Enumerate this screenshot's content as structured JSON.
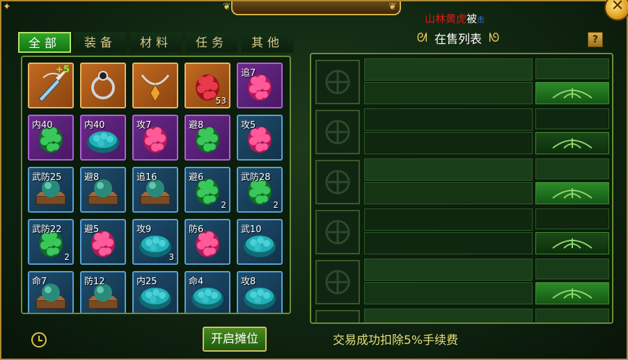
{
  "broadcast": {
    "name": "山林黄虎",
    "word": "被",
    "tail": "击"
  },
  "close_icon": "close-x-icon",
  "tabs": [
    {
      "label": "全部",
      "active": true
    },
    {
      "label": "装备",
      "active": false
    },
    {
      "label": "材料",
      "active": false
    },
    {
      "label": "任务",
      "active": false
    },
    {
      "label": "其他",
      "active": false
    }
  ],
  "inventory": [
    {
      "label": "",
      "plus": "+5",
      "count": "",
      "quality": "orange",
      "icon": "dagger-icon"
    },
    {
      "label": "",
      "plus": "",
      "count": "",
      "quality": "orange",
      "icon": "ring-icon"
    },
    {
      "label": "",
      "plus": "",
      "count": "",
      "quality": "orange",
      "icon": "amulet-icon"
    },
    {
      "label": "",
      "plus": "",
      "count": "53",
      "quality": "orange",
      "icon": "red-gem-icon"
    },
    {
      "label": "追7",
      "plus": "",
      "count": "",
      "quality": "purple",
      "icon": "pink-gem-icon"
    },
    {
      "label": "内40",
      "plus": "",
      "count": "",
      "quality": "purple",
      "icon": "green-gem-icon"
    },
    {
      "label": "内40",
      "plus": "",
      "count": "",
      "quality": "purple",
      "icon": "teal-gem-icon"
    },
    {
      "label": "攻7",
      "plus": "",
      "count": "",
      "quality": "purple",
      "icon": "pink-gem-icon"
    },
    {
      "label": "避8",
      "plus": "",
      "count": "",
      "quality": "purple",
      "icon": "green-gem-icon"
    },
    {
      "label": "攻5",
      "plus": "",
      "count": "",
      "quality": "blue",
      "icon": "pink-gem-icon"
    },
    {
      "label": "武防25",
      "plus": "",
      "count": "",
      "quality": "blue",
      "icon": "orb-chest-icon"
    },
    {
      "label": "避8",
      "plus": "",
      "count": "",
      "quality": "blue",
      "icon": "orb-chest-icon"
    },
    {
      "label": "追16",
      "plus": "",
      "count": "",
      "quality": "blue",
      "icon": "orb-chest-icon"
    },
    {
      "label": "避6",
      "plus": "",
      "count": "2",
      "quality": "blue",
      "icon": "green-gem-icon"
    },
    {
      "label": "武防28",
      "plus": "",
      "count": "2",
      "quality": "blue",
      "icon": "green-gem-icon"
    },
    {
      "label": "武防22",
      "plus": "",
      "count": "2",
      "quality": "blue",
      "icon": "green-gem-icon"
    },
    {
      "label": "避5",
      "plus": "",
      "count": "",
      "quality": "blue",
      "icon": "pink-gem-icon"
    },
    {
      "label": "攻9",
      "plus": "",
      "count": "3",
      "quality": "blue",
      "icon": "teal-gem-icon"
    },
    {
      "label": "防6",
      "plus": "",
      "count": "",
      "quality": "blue",
      "icon": "pink-gem-icon"
    },
    {
      "label": "武10",
      "plus": "",
      "count": "",
      "quality": "blue",
      "icon": "teal-gem-icon"
    },
    {
      "label": "命7",
      "plus": "",
      "count": "",
      "quality": "blue",
      "icon": "orb-chest-icon"
    },
    {
      "label": "防12",
      "plus": "",
      "count": "",
      "quality": "blue",
      "icon": "orb-chest-icon"
    },
    {
      "label": "内25",
      "plus": "",
      "count": "",
      "quality": "blue",
      "icon": "teal-gem-icon"
    },
    {
      "label": "命4",
      "plus": "",
      "count": "",
      "quality": "blue",
      "icon": "teal-gem-icon"
    },
    {
      "label": "攻8",
      "plus": "",
      "count": "",
      "quality": "blue",
      "icon": "teal-gem-icon"
    }
  ],
  "sale_list": {
    "title": "在售列表",
    "help_label": "?",
    "slots": [
      {
        "state": "empty"
      },
      {
        "state": "empty-dim"
      },
      {
        "state": "empty"
      },
      {
        "state": "empty-dim"
      },
      {
        "state": "empty"
      }
    ]
  },
  "footer": {
    "clock_icon": "clock-icon",
    "open_stall_label": "开启摊位",
    "fee_notice": "交易成功扣除5%手续费"
  },
  "colors": {
    "orange_quality": "#c26a20",
    "purple_quality": "#6a2a8a",
    "blue_quality": "#1e4d6e",
    "accent_gold": "#e2c25b",
    "active_tab": "#2fa42a"
  }
}
